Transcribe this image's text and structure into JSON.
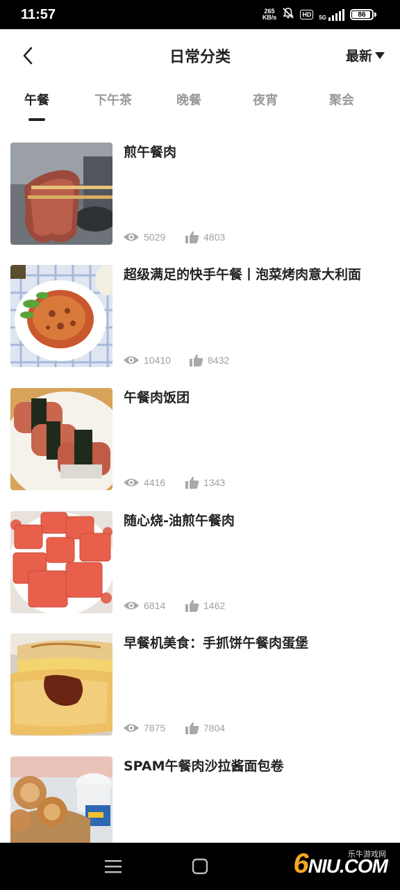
{
  "status_bar": {
    "time": "11:57",
    "net_speed_value": "265",
    "net_speed_unit": "KB/s",
    "hd_label": "HD",
    "network_label": "5G",
    "battery_level": "86"
  },
  "header": {
    "title": "日常分类",
    "sort_label": "最新",
    "back_icon": "chevron-left-icon",
    "sort_icon": "triangle-down-icon"
  },
  "tabs": [
    {
      "label": "午餐",
      "active": true
    },
    {
      "label": "下午茶",
      "active": false
    },
    {
      "label": "晚餐",
      "active": false
    },
    {
      "label": "夜宵",
      "active": false
    },
    {
      "label": "聚会",
      "active": false
    }
  ],
  "recipes": [
    {
      "title": "煎午餐肉",
      "views": "5029",
      "likes": "4803"
    },
    {
      "title": "超级满足的快手午餐丨泡菜烤肉意大利面",
      "views": "10410",
      "likes": "8432"
    },
    {
      "title": "午餐肉饭团",
      "views": "4416",
      "likes": "1343"
    },
    {
      "title": "随心烧-油煎午餐肉",
      "views": "6814",
      "likes": "1462"
    },
    {
      "title": "早餐机美食：手抓饼午餐肉蛋堡",
      "views": "7875",
      "likes": "7804"
    },
    {
      "title": "SPAM午餐肉沙拉酱面包卷",
      "views": "",
      "likes": ""
    }
  ],
  "nav_bar": {
    "menu_icon": "menu-icon",
    "home_icon": "home-square-icon"
  },
  "watermark": {
    "logo_digit": "6",
    "logo_text": "NIU.COM",
    "small_text": "乐牛游戏网"
  },
  "colors": {
    "text_primary": "#222222",
    "text_muted": "#9a9a9a",
    "stat_gray": "#a0a0a0",
    "bar_black": "#000000"
  }
}
